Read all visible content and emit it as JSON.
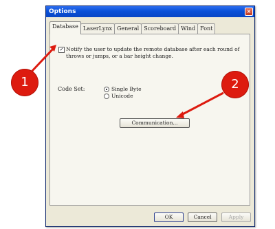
{
  "window": {
    "title": "Options",
    "close_glyph": "×"
  },
  "tabs": [
    {
      "label": "Database",
      "active": true
    },
    {
      "label": "LaserLynx",
      "active": false
    },
    {
      "label": "General",
      "active": false
    },
    {
      "label": "Scoreboard",
      "active": false
    },
    {
      "label": "Wind",
      "active": false
    },
    {
      "label": "Font",
      "active": false
    }
  ],
  "database": {
    "notify_checked": true,
    "notify_check_glyph": "✓",
    "notify_text": "Notify the user to update the remote database after each round of throws or jumps, or a bar height change.",
    "codeset_label": "Code Set:",
    "codeset_options": [
      {
        "label": "Single Byte",
        "selected": true
      },
      {
        "label": "Unicode",
        "selected": false
      }
    ],
    "communication_button": "Communication..."
  },
  "buttons": {
    "ok": "OK",
    "cancel": "Cancel",
    "apply": "Apply"
  },
  "markers": [
    {
      "label": "1"
    },
    {
      "label": "2"
    }
  ],
  "colors": {
    "marker": "#dd1b0f",
    "titlebar": "#0a50d8"
  }
}
